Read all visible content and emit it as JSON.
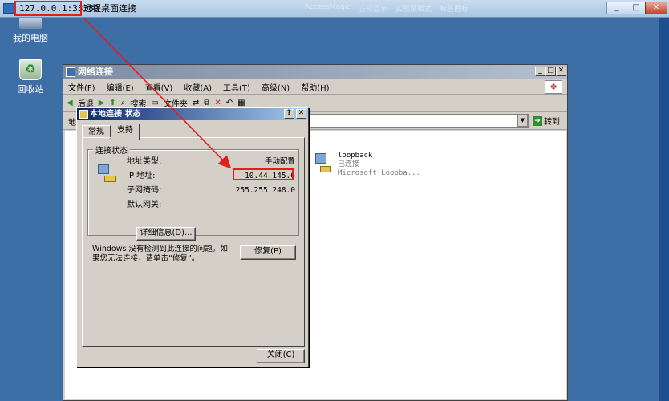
{
  "rdp": {
    "address": "127.0.0.1:33389",
    "title": "远程桌面连接",
    "ghost_tabs": [
      "AccessMagic",
      "正常显示",
      "实验区模式",
      "标签图标"
    ],
    "min": "_",
    "max": "□",
    "close": "✕"
  },
  "desktop": {
    "icons": [
      {
        "label": "我的电脑",
        "icon": "computer-icon"
      },
      {
        "label": "回收站",
        "icon": "recycle-bin-icon"
      }
    ]
  },
  "net_window": {
    "title": "网络连接",
    "menu": [
      "文件(F)",
      "编辑(E)",
      "查看(V)",
      "收藏(A)",
      "工具(T)",
      "高级(N)",
      "帮助(H)"
    ],
    "toolbar": {
      "back": "后退",
      "search": "搜索",
      "folders": "文件夹"
    },
    "address_label": "地",
    "go_label": "转到",
    "item": {
      "name": "loopback",
      "status": "已连接",
      "device": "Microsoft Loopba..."
    }
  },
  "status_dialog": {
    "title": "本地连接 状态",
    "help_btn": "?",
    "close_btn": "✕",
    "tabs": [
      "常规",
      "支持"
    ],
    "group_label": "连接状态",
    "rows": [
      {
        "key": "地址类型:",
        "value": "手动配置"
      },
      {
        "key": "IP 地址:",
        "value": "10.44.145.6"
      },
      {
        "key": "子网掩码:",
        "value": "255.255.248.0"
      },
      {
        "key": "默认网关:",
        "value": ""
      }
    ],
    "details_btn": "详细信息(D)...",
    "message": "Windows 没有检测到此连接的问题。如果您无法连接，请单击“修复”。",
    "repair_btn": "修复(P)",
    "close_action": "关闭(C)"
  },
  "colors": {
    "annotation_red": "#e0201c",
    "desktop_blue": "#3d6ea5"
  }
}
